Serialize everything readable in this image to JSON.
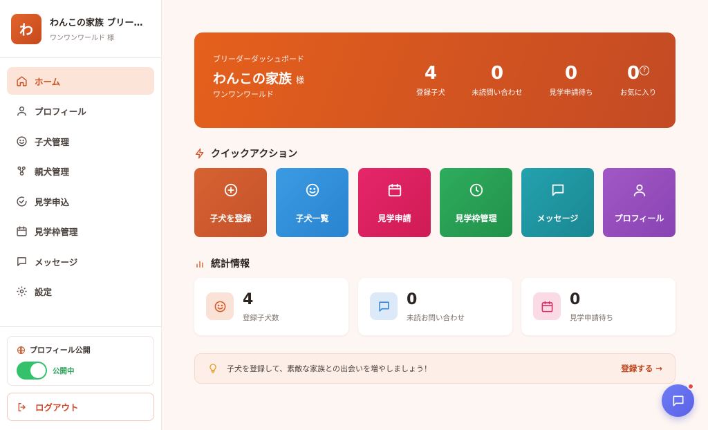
{
  "brand": {
    "logo_char": "わ",
    "name": "わんこの家族 ブリーダー",
    "sub": "ワンワンワールド 様"
  },
  "nav": {
    "items": [
      {
        "label": "ホーム",
        "icon": "home-icon"
      },
      {
        "label": "プロフィール",
        "icon": "user-icon"
      },
      {
        "label": "子犬管理",
        "icon": "smile-icon"
      },
      {
        "label": "親犬管理",
        "icon": "paw-icon"
      },
      {
        "label": "見学申込",
        "icon": "check-circle-icon"
      },
      {
        "label": "見学枠管理",
        "icon": "calendar-icon"
      },
      {
        "label": "メッセージ",
        "icon": "message-icon"
      },
      {
        "label": "設定",
        "icon": "gear-icon"
      }
    ]
  },
  "profile_public": {
    "title": "プロフィール公開",
    "status": "公開中",
    "enabled": true
  },
  "logout": {
    "label": "ログアウト"
  },
  "hero": {
    "kicker": "ブリーダーダッシュボード",
    "title": "わんこの家族",
    "title_suffix": "様",
    "org": "ワンワンワールド",
    "stats": [
      {
        "value": "4",
        "label": "登録子犬"
      },
      {
        "value": "0",
        "label": "未読問い合わせ"
      },
      {
        "value": "0",
        "label": "見学申請待ち"
      },
      {
        "value": "0",
        "label": "お気に入り",
        "help": "?"
      }
    ]
  },
  "quick_actions": {
    "title": "クイックアクション",
    "items": [
      {
        "label": "子犬を登録",
        "icon": "plus-circle-icon",
        "color": "#cf5a2c"
      },
      {
        "label": "子犬一覧",
        "icon": "smile-icon",
        "color": "#2f8fdc"
      },
      {
        "label": "見学申請",
        "icon": "calendar-icon",
        "color": "#df1f5f"
      },
      {
        "label": "見学枠管理",
        "icon": "clock-icon",
        "color": "#27a255"
      },
      {
        "label": "メッセージ",
        "icon": "message-icon",
        "color": "#1f9aa6"
      },
      {
        "label": "プロフィール",
        "icon": "user-icon",
        "color": "#9a4fc0"
      }
    ]
  },
  "stats_section": {
    "title": "統計情報",
    "cards": [
      {
        "value": "4",
        "label": "登録子犬数",
        "icon": "smile-icon",
        "bg": "#fbe2d6",
        "fg": "#d25a2a"
      },
      {
        "value": "0",
        "label": "未読お問い合わせ",
        "icon": "message-icon",
        "bg": "#dbe9f8",
        "fg": "#3585d3"
      },
      {
        "value": "0",
        "label": "見学申請待ち",
        "icon": "calendar-icon",
        "bg": "#fadbe5",
        "fg": "#d92e64"
      }
    ]
  },
  "tip": {
    "text": "子犬を登録して、素敵な家族との出会いを増やしましょう！",
    "link": "登録する →"
  }
}
